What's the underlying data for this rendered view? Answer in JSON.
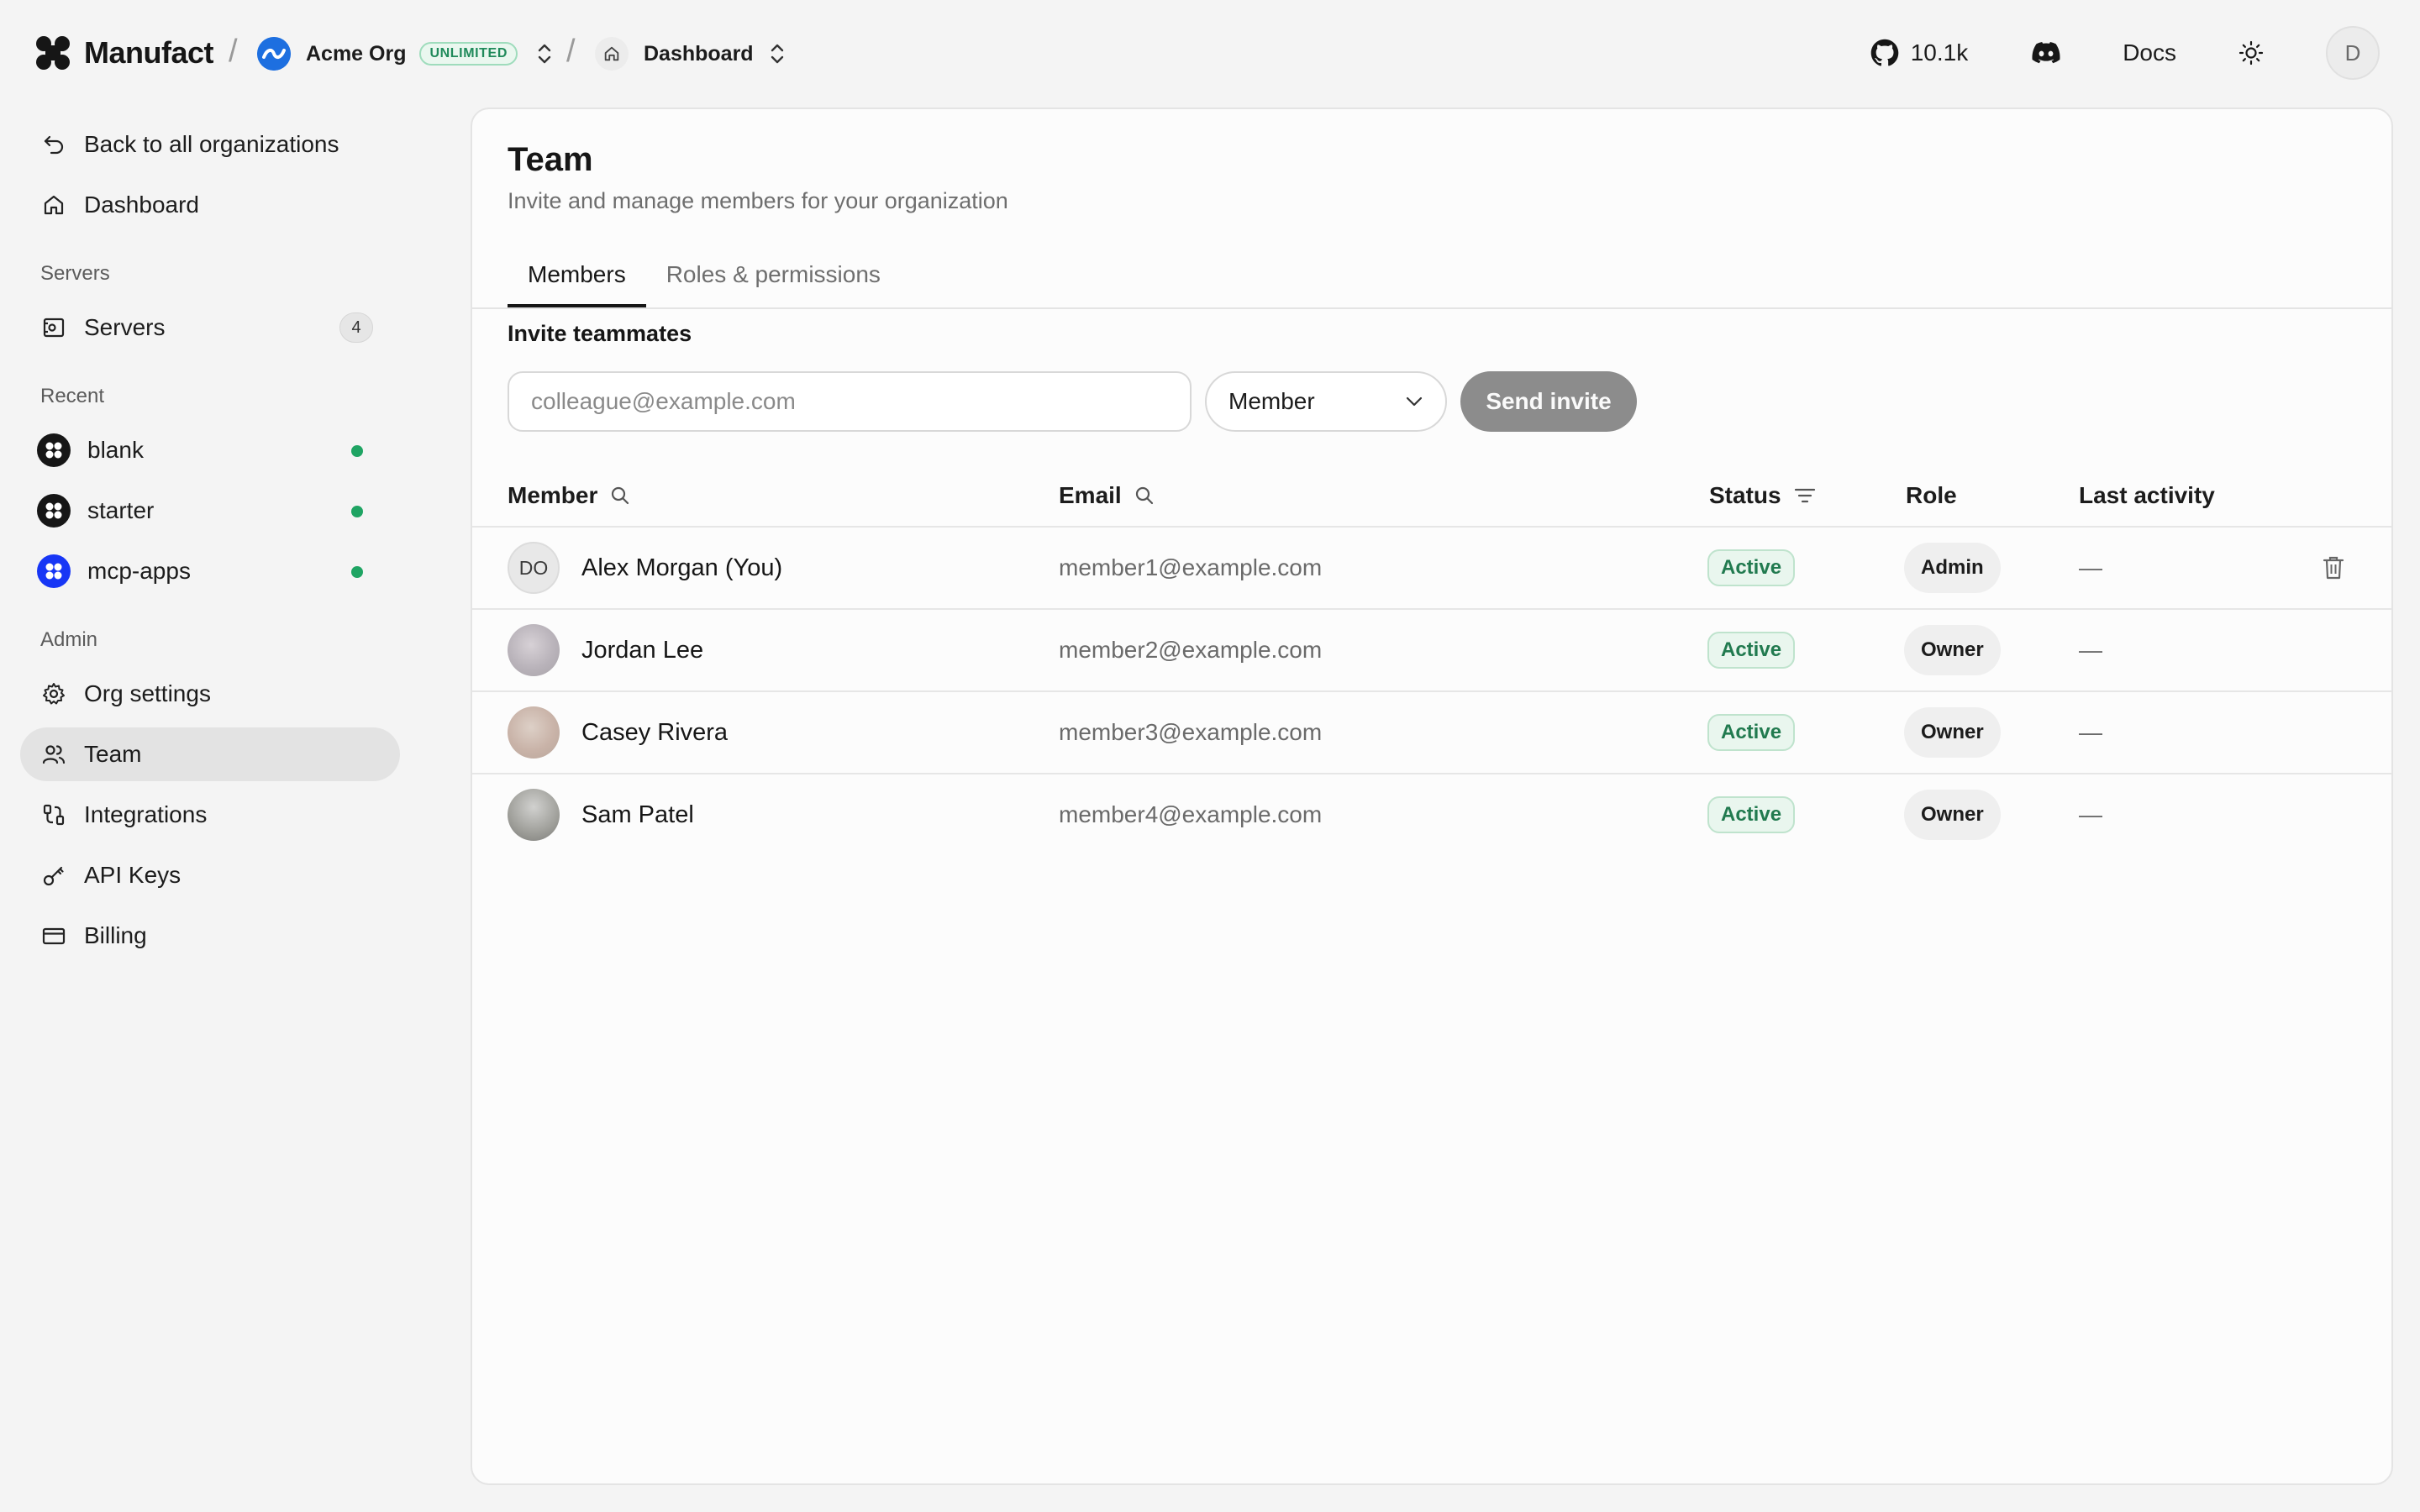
{
  "brand": {
    "name": "Manufact"
  },
  "breadcrumb": {
    "separator": "/",
    "org_name": "Acme Org",
    "org_plan_badge": "UNLIMITED",
    "page": "Dashboard"
  },
  "topbar": {
    "github_stars": "10.1k",
    "docs_label": "Docs",
    "user_initial": "D"
  },
  "sidebar": {
    "back_label": "Back to all organizations",
    "dashboard_label": "Dashboard",
    "servers_section": "Servers",
    "servers_label": "Servers",
    "servers_count": "4",
    "recent_section": "Recent",
    "recent": [
      {
        "name": "blank",
        "status_color": "#1fa463"
      },
      {
        "name": "starter",
        "status_color": "#1fa463"
      },
      {
        "name": "mcp-apps",
        "status_color": "#1fa463"
      }
    ],
    "admin_section": "Admin",
    "admin_items": [
      {
        "label": "Org settings",
        "icon": "gear-icon"
      },
      {
        "label": "Team",
        "icon": "users-icon",
        "active": true
      },
      {
        "label": "Integrations",
        "icon": "integrations-icon"
      },
      {
        "label": "API Keys",
        "icon": "key-icon"
      },
      {
        "label": "Billing",
        "icon": "credit-card-icon"
      }
    ]
  },
  "main": {
    "title": "Team",
    "subtitle": "Invite and manage members for your organization",
    "tabs": [
      {
        "label": "Members",
        "active": true
      },
      {
        "label": "Roles & permissions",
        "active": false
      }
    ],
    "invite": {
      "title": "Invite teammates",
      "email_placeholder": "colleague@example.com",
      "email_value": "",
      "role_selected": "Member",
      "send_label": "Send invite"
    },
    "table": {
      "columns": [
        "Member",
        "Email",
        "Status",
        "Role",
        "Last activity"
      ],
      "rows": [
        {
          "initials": "DO",
          "name": "Alex Morgan (You)",
          "email": "member1@example.com",
          "status": "Active",
          "role": "Admin",
          "last_activity": "—"
        },
        {
          "initials": "",
          "name": "Jordan Lee",
          "email": "member2@example.com",
          "status": "Active",
          "role": "Owner",
          "last_activity": "—"
        },
        {
          "initials": "",
          "name": "Casey Rivera",
          "email": "member3@example.com",
          "status": "Active",
          "role": "Owner",
          "last_activity": "—"
        },
        {
          "initials": "",
          "name": "Sam Patel",
          "email": "member4@example.com",
          "status": "Active",
          "role": "Owner",
          "last_activity": "—"
        }
      ]
    }
  },
  "colors": {
    "accent_green": "#1fa463",
    "org_avatar_blue": "#1d6fe0",
    "send_button_disabled": "#8c8c8c"
  }
}
